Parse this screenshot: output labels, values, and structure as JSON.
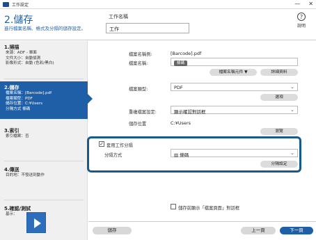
{
  "window": {
    "title": "工作設定"
  },
  "header": {
    "step_title": "2.儲存",
    "step_subtitle": "進行檔案名稱、格式及分隔的儲存設定。",
    "job_name_label": "工作名稱",
    "job_name_value": "工作",
    "help_label": "說明"
  },
  "sidebar": {
    "scan": {
      "title": "1.掃描",
      "lines": [
        "來源：ADF - 單面",
        "文件大小：自動偵測",
        "影像形式：自動 (色彩/黑白)"
      ]
    },
    "save": {
      "title": "2.儲存",
      "lines": [
        "檔案名稱：[Barcode].pdf",
        "檔案類型：PDF",
        "儲存位置：C:¥Users",
        "分隔方式 條碼"
      ]
    },
    "index": {
      "title": "3.索引",
      "lines": [
        "索引檔案：否"
      ]
    },
    "send": {
      "title": "4.傳送",
      "lines": [
        "目的地：不發送到動作"
      ]
    },
    "confirm": {
      "title": "5.確認/測試",
      "lines": [
        "基示："
      ]
    }
  },
  "main": {
    "filename_example_label": "檔案名稱例:",
    "filename_example_value": "[Barcode].pdf",
    "filename_label": "檔案名稱:",
    "filename_tag": "條碼",
    "filename_element_btn": "檔案名稱元件 ▼",
    "detail_btn": "詳細資料",
    "filetype_label": "檔案類型:",
    "filetype_value": "PDF",
    "option_btn": "選項",
    "duplicate_label": "重複檔案設定:",
    "duplicate_value": "顯示確認對話框",
    "location_label": "儲存位置",
    "location_value": "C:¥Users",
    "browse_btn": "瀏覽",
    "apply_separation_label": "套用工作分隔",
    "apply_separation_checked": true,
    "separation_method_label": "分隔方式",
    "separation_method_value": "條碼",
    "separation_settings_btn": "分隔設定",
    "show_dialog_label": "儲存前顯示「檔案頁面」對話框"
  },
  "footer": {
    "save_btn": "儲存",
    "prev_btn": "上一頁",
    "next_btn": "下一頁"
  },
  "colors": {
    "accent": "#1e5fa8",
    "highlight": "#1a5a8a"
  }
}
